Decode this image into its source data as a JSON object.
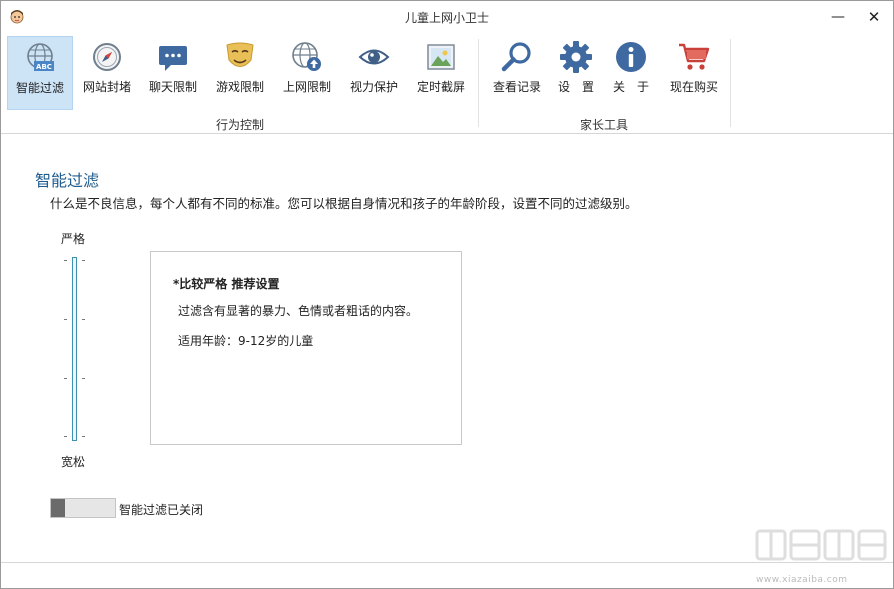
{
  "window": {
    "title": "儿童上网小卫士",
    "minimize": "—",
    "close": "✕"
  },
  "toolbar": {
    "behavior_group_label": "行为控制",
    "parent_group_label": "家长工具",
    "items": [
      {
        "label": "智能过滤",
        "icon": "abc-globe-icon"
      },
      {
        "label": "网站封堵",
        "icon": "compass-icon"
      },
      {
        "label": "聊天限制",
        "icon": "chat-bubble-icon"
      },
      {
        "label": "游戏限制",
        "icon": "drama-mask-icon"
      },
      {
        "label": "上网限制",
        "icon": "globe-upload-icon"
      },
      {
        "label": "视力保护",
        "icon": "eye-icon"
      },
      {
        "label": "定时截屏",
        "icon": "picture-icon"
      },
      {
        "label": "查看记录",
        "icon": "magnifier-icon"
      },
      {
        "label": "设　置",
        "icon": "gear-icon"
      },
      {
        "label": "关　于",
        "icon": "info-icon"
      },
      {
        "label": "现在购买",
        "icon": "cart-icon"
      }
    ]
  },
  "filter": {
    "title": "智能过滤",
    "description": "什么是不良信息，每个人都有不同的标准。您可以根据自身情况和孩子的年龄阶段，设置不同的过滤级别。",
    "strict_label": "严格",
    "loose_label": "宽松",
    "level": {
      "heading": "*比较严格 推荐设置",
      "detail": "过滤含有显著的暴力、色情或者粗话的内容。",
      "age": "适用年龄：9-12岁的儿童"
    },
    "toggle_label": "智能过滤已关闭",
    "toggle_on": false
  },
  "watermark": {
    "text": "www.xiazaiba.com"
  },
  "colors": {
    "accent": "#1f5c8f",
    "active_tool": "#cde4f7",
    "slider": "#3e8fb0"
  }
}
